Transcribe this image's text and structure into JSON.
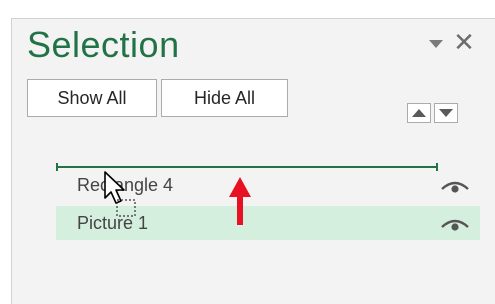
{
  "pane": {
    "title": "Selection",
    "options_icon": "caret-down-icon",
    "close_icon": "close-icon",
    "close_glyph": "✕",
    "accent_color": "#217346"
  },
  "toolbar": {
    "show_all_label": "Show All",
    "hide_all_label": "Hide All",
    "bring_forward_icon": "triangle-up-icon",
    "send_backward_icon": "triangle-down-icon"
  },
  "list": {
    "drop_indicator_color": "#217346",
    "items": [
      {
        "label": "Rectangle 4",
        "visible": true,
        "selected": false,
        "visibility_icon": "eye-icon"
      },
      {
        "label": "Picture 1",
        "visible": true,
        "selected": true,
        "visibility_icon": "eye-icon"
      }
    ],
    "selected_row_color": "#d5efdf"
  },
  "annotation": {
    "arrow_icon": "red-up-arrow-icon",
    "arrow_color": "#e81123"
  },
  "pointer": {
    "icon": "drag-move-cursor-icon"
  }
}
